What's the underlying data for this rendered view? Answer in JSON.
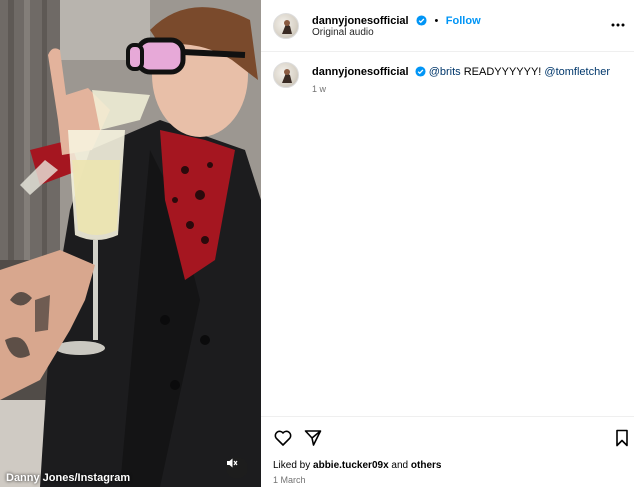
{
  "post": {
    "username": "dannyjonesofficial",
    "follow_label": "Follow",
    "audio_label": "Original audio",
    "caption_mention_1": "@brits",
    "caption_text": " READYYYYYY! ",
    "caption_mention_2": "@tomfletcher",
    "time_ago": "1 w",
    "liked_by_prefix": "Liked by ",
    "liked_by_user": "abbie.tucker09x",
    "liked_by_and": " and ",
    "liked_by_others": "others",
    "date": "1 March"
  },
  "media": {
    "credit": "Danny Jones/Instagram"
  },
  "colors": {
    "accent": "#0095f6",
    "mention": "#00376b",
    "verified": "#0095f6"
  },
  "icons": [
    "heart-icon",
    "share-icon",
    "bookmark-icon",
    "more-icon",
    "verified-icon",
    "mute-icon"
  ]
}
